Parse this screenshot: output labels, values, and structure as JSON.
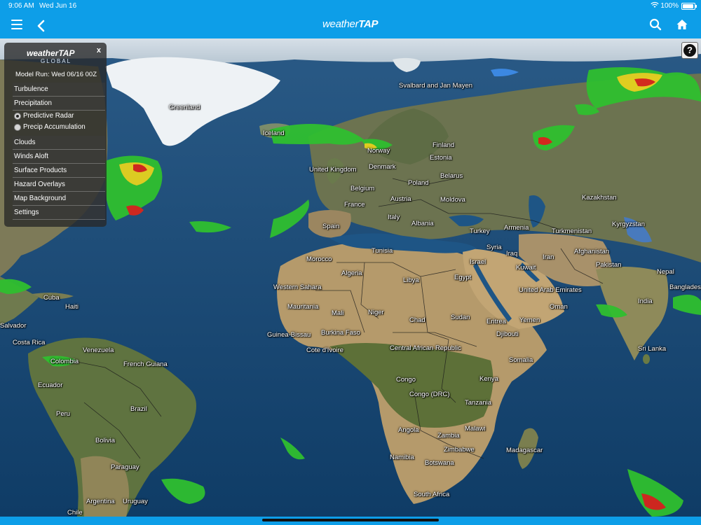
{
  "status_bar": {
    "time": "9:06 AM",
    "date": "Wed Jun 16",
    "battery": "100%"
  },
  "header": {
    "logo_prefix": "weather",
    "logo_suffix": "TAP",
    "icons": [
      "menu-icon",
      "back-icon",
      "search-icon",
      "home-icon"
    ]
  },
  "help": {
    "label": "?"
  },
  "panel": {
    "close": "x",
    "brand": "weatherTAP",
    "brand_sub": "GLOBAL",
    "model_run": "Model Run: Wed 06/16 00Z",
    "items": {
      "turbulence": "Turbulence",
      "precipitation": "Precipitation",
      "predictive_radar": "Predictive Radar",
      "precip_accumulation": "Precip Accumulation",
      "clouds": "Clouds",
      "winds_aloft": "Winds Aloft",
      "surface_products": "Surface Products",
      "hazard_overlays": "Hazard Overlays",
      "map_background": "Map Background",
      "settings": "Settings"
    },
    "selected_radio": "Predictive Radar"
  },
  "map_labels": [
    {
      "key": "greenland",
      "text": "Greenland"
    },
    {
      "key": "svalbard",
      "text": "Svalbard and Jan Mayen"
    },
    {
      "key": "iceland",
      "text": "Iceland"
    },
    {
      "key": "finland",
      "text": "Finland"
    },
    {
      "key": "norway",
      "text": "Norway"
    },
    {
      "key": "estonia",
      "text": "Estonia"
    },
    {
      "key": "united_kingdom",
      "text": "United Kingdom"
    },
    {
      "key": "denmark",
      "text": "Denmark"
    },
    {
      "key": "belarus",
      "text": "Belarus"
    },
    {
      "key": "belgium",
      "text": "Belgium"
    },
    {
      "key": "poland",
      "text": "Poland"
    },
    {
      "key": "kazakhstan",
      "text": "Kazakhstan"
    },
    {
      "key": "austria",
      "text": "Austria"
    },
    {
      "key": "moldova",
      "text": "Moldova"
    },
    {
      "key": "france",
      "text": "France"
    },
    {
      "key": "spain",
      "text": "Spain"
    },
    {
      "key": "italy",
      "text": "Italy"
    },
    {
      "key": "albania",
      "text": "Albania"
    },
    {
      "key": "turkey",
      "text": "Turkey"
    },
    {
      "key": "armenia",
      "text": "Armenia"
    },
    {
      "key": "turkmenistan",
      "text": "Turkmenistan"
    },
    {
      "key": "kyrgyzstan",
      "text": "Kyrgyzstan"
    },
    {
      "key": "tunisia",
      "text": "Tunisia"
    },
    {
      "key": "syria",
      "text": "Syria"
    },
    {
      "key": "iraq",
      "text": "Iraq"
    },
    {
      "key": "afghanistan",
      "text": "Afghanistan"
    },
    {
      "key": "israel",
      "text": "Israel"
    },
    {
      "key": "iran",
      "text": "Iran"
    },
    {
      "key": "morocco",
      "text": "Morocco"
    },
    {
      "key": "algeria",
      "text": "Algeria"
    },
    {
      "key": "kuwait",
      "text": "Kuwait"
    },
    {
      "key": "pakistan",
      "text": "Pakistan"
    },
    {
      "key": "nepal",
      "text": "Nepal"
    },
    {
      "key": "libya",
      "text": "Libya"
    },
    {
      "key": "egypt",
      "text": "Egypt"
    },
    {
      "key": "western_sahara",
      "text": "Western Sahara"
    },
    {
      "key": "uae",
      "text": "United Arab Emirates"
    },
    {
      "key": "bangladesh",
      "text": "Banglades"
    },
    {
      "key": "cuba",
      "text": "Cuba"
    },
    {
      "key": "mauritania",
      "text": "Mauritania"
    },
    {
      "key": "haiti",
      "text": "Haiti"
    },
    {
      "key": "mali",
      "text": "Mali"
    },
    {
      "key": "niger",
      "text": "Niger"
    },
    {
      "key": "oman",
      "text": "Oman"
    },
    {
      "key": "india",
      "text": "India"
    },
    {
      "key": "sudan",
      "text": "Sudan"
    },
    {
      "key": "chad",
      "text": "Chad"
    },
    {
      "key": "salvador",
      "text": "Salvador"
    },
    {
      "key": "eritrea",
      "text": "Eritrea"
    },
    {
      "key": "yemen",
      "text": "Yemen"
    },
    {
      "key": "guinea_bissau",
      "text": "Guinea-Bissau"
    },
    {
      "key": "burkina_faso",
      "text": "Burkina Faso"
    },
    {
      "key": "djibouti",
      "text": "Djibouti"
    },
    {
      "key": "costa_rica",
      "text": "Costa Rica"
    },
    {
      "key": "cote_divoire",
      "text": "Cote d'Ivoire"
    },
    {
      "key": "car",
      "text": "Central African Republic"
    },
    {
      "key": "sri_lanka",
      "text": "Sri Lanka"
    },
    {
      "key": "venezuela",
      "text": "Venezuela"
    },
    {
      "key": "somalia",
      "text": "Somalia"
    },
    {
      "key": "colombia",
      "text": "Colombia"
    },
    {
      "key": "french_guiana",
      "text": "French Guiana"
    },
    {
      "key": "congo",
      "text": "Congo"
    },
    {
      "key": "ecuador",
      "text": "Ecuador"
    },
    {
      "key": "kenya",
      "text": "Kenya"
    },
    {
      "key": "congo_drc",
      "text": "Congo (DRC)"
    },
    {
      "key": "tanzania",
      "text": "Tanzania"
    },
    {
      "key": "brazil",
      "text": "Brazil"
    },
    {
      "key": "peru",
      "text": "Peru"
    },
    {
      "key": "angola",
      "text": "Angola"
    },
    {
      "key": "malawi",
      "text": "Malawi"
    },
    {
      "key": "zambia",
      "text": "Zambia"
    },
    {
      "key": "bolivia",
      "text": "Bolivia"
    },
    {
      "key": "zimbabwe",
      "text": "Zimbabwe"
    },
    {
      "key": "madagascar",
      "text": "Madagascar"
    },
    {
      "key": "namibia",
      "text": "Namibia"
    },
    {
      "key": "botswana",
      "text": "Botswana"
    },
    {
      "key": "paraguay",
      "text": "Paraguay"
    },
    {
      "key": "south_africa",
      "text": "South Africa"
    },
    {
      "key": "argentina",
      "text": "Argentina"
    },
    {
      "key": "uruguay",
      "text": "Uruguay"
    },
    {
      "key": "chile",
      "text": "Chile"
    }
  ],
  "colors": {
    "header_blue": "#0d9ee8",
    "ocean": "#134a78",
    "land": "#b89c6e",
    "radar_green": "#2fbf2f",
    "radar_yellow": "#e6d21e",
    "radar_red": "#d8261c"
  }
}
